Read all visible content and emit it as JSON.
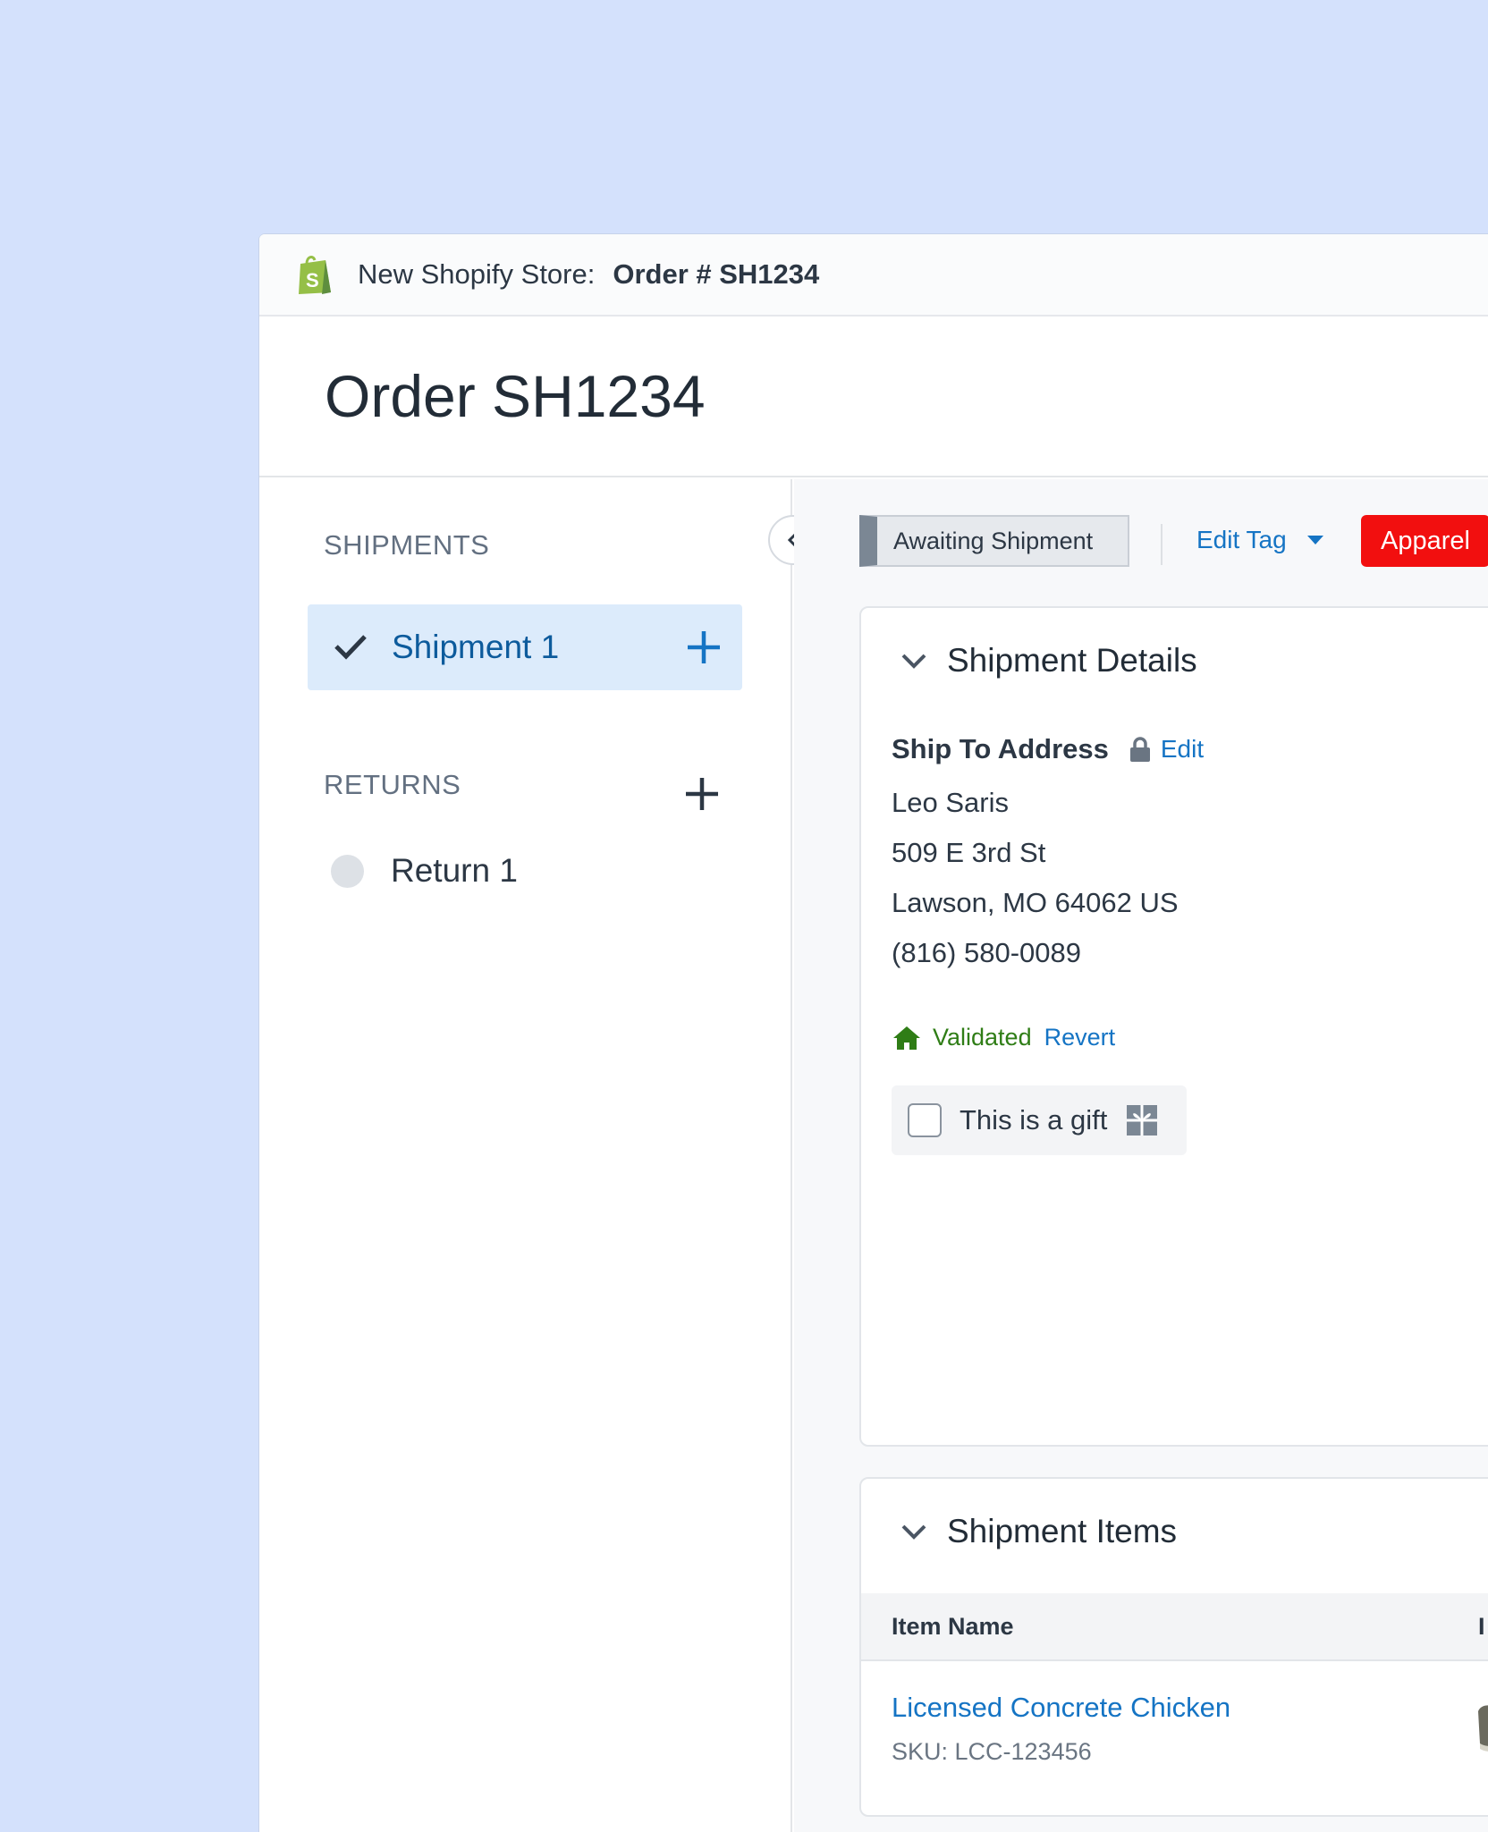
{
  "topbar": {
    "logo_icon": "shopify-bag-icon",
    "store_label": "New Shopify Store:",
    "order_crumb": "Order # SH1234"
  },
  "header": {
    "title": "Order SH1234"
  },
  "sidebar": {
    "shipments_label": "SHIPMENTS",
    "shipments": [
      {
        "label": "Shipment 1",
        "status": "complete"
      }
    ],
    "returns_label": "RETURNS",
    "returns": [
      {
        "label": "Return 1",
        "status": "pending"
      }
    ]
  },
  "toolbar": {
    "status": "Awaiting Shipment",
    "edit_tag": "Edit Tag",
    "tag": "Apparel",
    "tag_color": "#f20f0f"
  },
  "shipment_details": {
    "title": "Shipment Details",
    "ship_to_label": "Ship To Address",
    "edit_label": "Edit",
    "address": {
      "name": "Leo Saris",
      "street": "509 E 3rd St",
      "city_line": "Lawson, MO 64062 US",
      "phone": "(816) 580-0089"
    },
    "validated_label": "Validated",
    "revert_label": "Revert",
    "gift_label": "This is a gift",
    "gift_checked": false
  },
  "shipment_items": {
    "title": "Shipment Items",
    "columns": [
      "Item Name",
      "I"
    ],
    "rows": [
      {
        "name": "Licensed Concrete Chicken",
        "sku": "SKU: LCC-123456"
      }
    ]
  },
  "colors": {
    "accent": "#1574c4",
    "success": "#2f7d16",
    "danger": "#f20f0f",
    "background": "#d4e1fc"
  }
}
